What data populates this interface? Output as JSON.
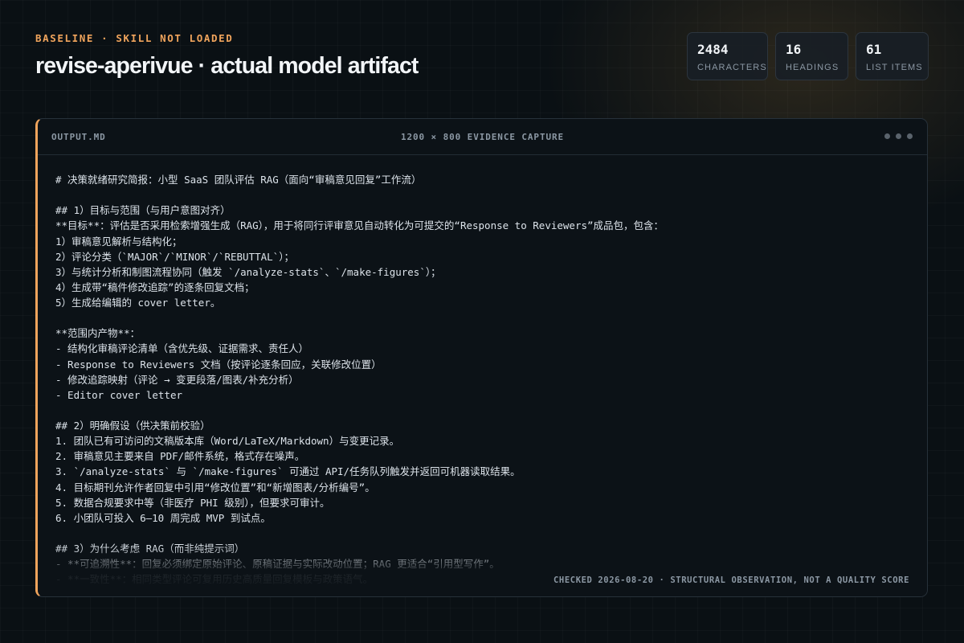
{
  "header": {
    "eyebrow": "BASELINE · SKILL NOT LOADED",
    "title": "revise-aperivue · actual model artifact"
  },
  "stats": [
    {
      "value": "2484",
      "label": "CHARACTERS"
    },
    {
      "value": "16",
      "label": "HEADINGS"
    },
    {
      "value": "61",
      "label": "LIST ITEMS"
    }
  ],
  "panel": {
    "file_name": "OUTPUT.MD",
    "capture_label": "1200 × 800 EVIDENCE CAPTURE",
    "footnote": "CHECKED 2026-08-20 · STRUCTURAL OBSERVATION, NOT A QUALITY SCORE",
    "lines": [
      "# 决策就绪研究简报：小型 SaaS 团队评估 RAG（面向“审稿意见回复”工作流）",
      "",
      "## 1）目标与范围（与用户意图对齐）",
      "**目标**：评估是否采用检索增强生成（RAG），用于将同行评审意见自动转化为可提交的“Response to Reviewers”成品包，包含：",
      "1）审稿意见解析与结构化；",
      "2）评论分类（`MAJOR`/`MINOR`/`REBUTTAL`）；",
      "3）与统计分析和制图流程协同（触发 `/analyze-stats`、`/make-figures`）；",
      "4）生成带“稿件修改追踪”的逐条回复文档；",
      "5）生成给编辑的 cover letter。",
      "",
      "**范围内产物**：",
      "- 结构化审稿评论清单（含优先级、证据需求、责任人）",
      "- Response to Reviewers 文档（按评论逐条回应，关联修改位置）",
      "- 修改追踪映射（评论 → 变更段落/图表/补充分析）",
      "- Editor cover letter",
      "",
      "## 2）明确假设（供决策前校验）",
      "1. 团队已有可访问的文稿版本库（Word/LaTeX/Markdown）与变更记录。",
      "2. 审稿意见主要来自 PDF/邮件系统，格式存在噪声。",
      "3. `/analyze-stats` 与 `/make-figures` 可通过 API/任务队列触发并返回可机器读取结果。",
      "4. 目标期刊允许作者回复中引用“修改位置”和“新增图表/分析编号”。",
      "5. 数据合规要求中等（非医疗 PHI 级别），但要求可审计。",
      "6. 小团队可投入 6–10 周完成 MVP 到试点。",
      "",
      "## 3）为什么考虑 RAG（而非纯提示词）",
      "- **可追溯性**：回复必须绑定原始评论、原稿证据与实际改动位置；RAG 更适合“引用型写作”。",
      "- **一致性**：相同类型评论可复用历史高质量回复模板与政策语气。"
    ]
  }
}
